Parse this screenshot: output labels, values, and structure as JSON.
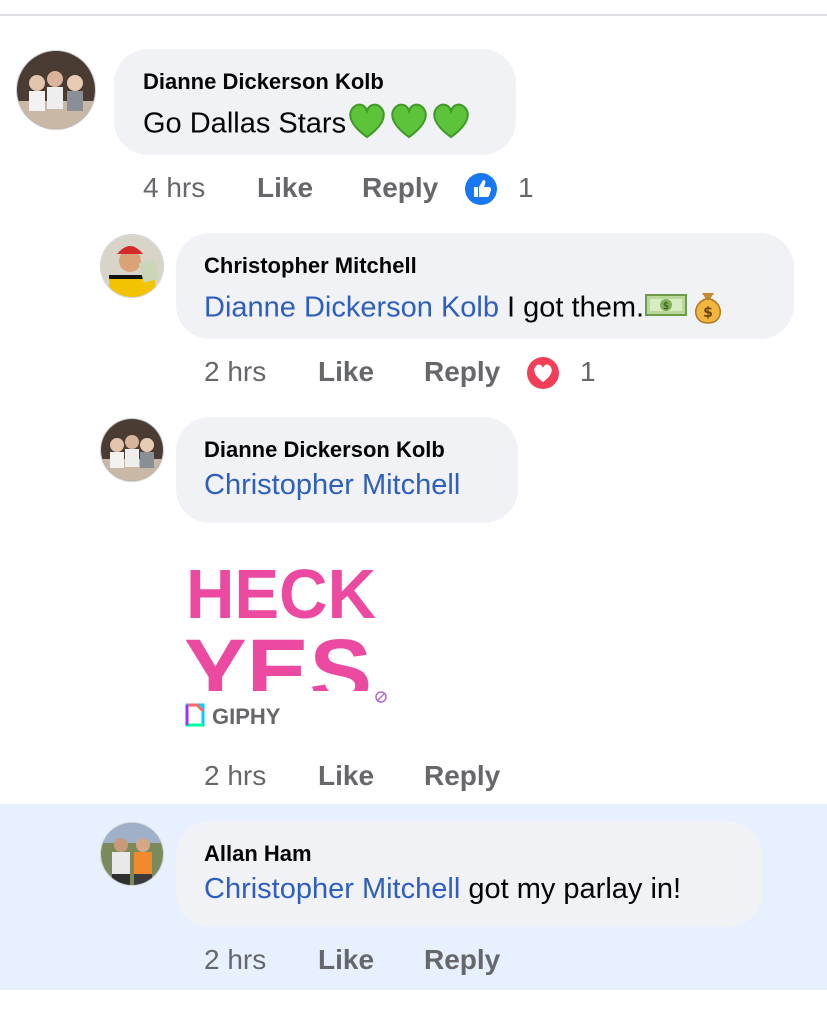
{
  "comments": [
    {
      "author": "Dianne Dickerson Kolb",
      "text": "Go Dallas Stars",
      "time": "4 hrs",
      "like": "Like",
      "reply": "Reply",
      "reaction": "like",
      "reaction_count": "1",
      "emoji": "green-heart x3"
    },
    {
      "author": "Christopher Mitchell",
      "mention": "Dianne Dickerson Kolb",
      "text": " I got them.",
      "time": "2 hrs",
      "like": "Like",
      "reply": "Reply",
      "reaction": "love",
      "reaction_count": "1",
      "emoji": "dollar-bill, money-bag"
    },
    {
      "author": "Dianne Dickerson Kolb",
      "mention": "Christopher Mitchell",
      "gif_text_line1": "HECK",
      "gif_text_line2": "YES",
      "gif_source": "GIPHY",
      "time": "2 hrs",
      "like": "Like",
      "reply": "Reply"
    },
    {
      "author": "Allan Ham",
      "mention": "Christopher Mitchell",
      "text": " got my parlay in!",
      "time": "2 hrs",
      "like": "Like",
      "reply": "Reply"
    }
  ],
  "colors": {
    "mention": "#2e5fbf",
    "bubble": "#f0f2f5",
    "highlight": "#e7f0fe",
    "like_reaction": "#1877f2",
    "love_reaction": "#f33e58",
    "gif_pink": "#ec4aa0"
  }
}
